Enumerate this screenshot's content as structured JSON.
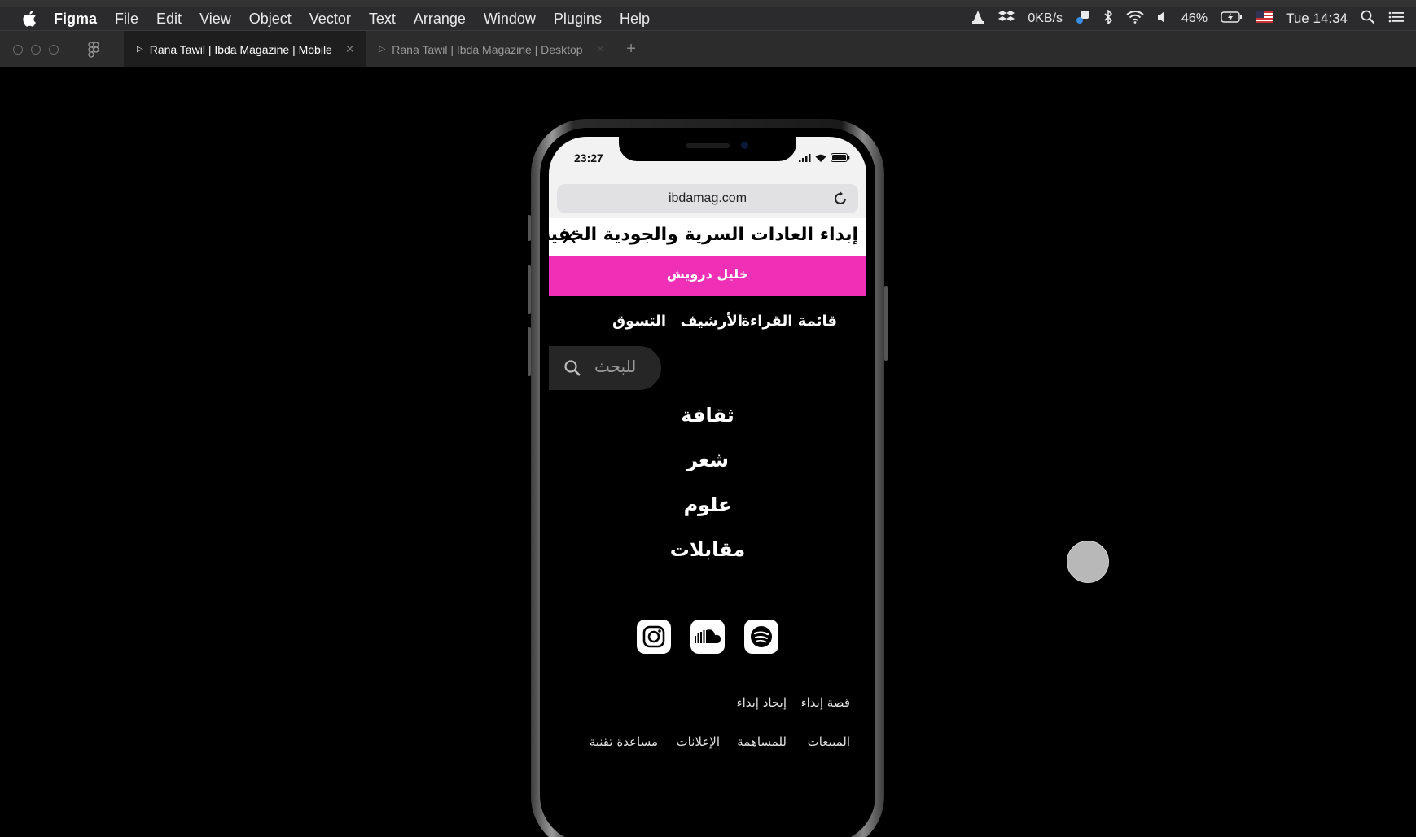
{
  "menubar": {
    "app_name": "Figma",
    "items": [
      "File",
      "Edit",
      "View",
      "Object",
      "Vector",
      "Text",
      "Arrange",
      "Window",
      "Plugins",
      "Help"
    ],
    "network_speed": "0KB/s",
    "battery": "46%",
    "clock": "Tue 14:34"
  },
  "tabs": [
    {
      "label": "Rana Tawil | Ibda Magazine | Mobile",
      "active": true
    },
    {
      "label": "Rana Tawil | Ibda Magazine | Desktop",
      "active": false
    }
  ],
  "phone": {
    "time": "23:27",
    "url": "ibdamag.com",
    "headline": "إبداء العادات السرية والجودية الخفية",
    "author": "خليل درويش",
    "nav": [
      "قائمة القراءة",
      "الأرشيف",
      "التسوق"
    ],
    "search_placeholder": "للبحث",
    "categories": [
      "ثقافة",
      "شعر",
      "علوم",
      "مقابلات"
    ],
    "socials": [
      "instagram-icon",
      "soundcloud-icon",
      "spotify-icon"
    ],
    "footer_row1": [
      "قصة إبداء",
      "إيجاد إبداء"
    ],
    "footer_row2": [
      "المبيعات",
      "للمساهمة",
      "الإعلانات",
      "مساعدة تقنية"
    ]
  },
  "colors": {
    "pink_accent": "#ef2fb5",
    "menubar_bg": "#2b2b2d",
    "tabbar_bg": "#2c2c2c",
    "canvas_bg": "#000000"
  }
}
